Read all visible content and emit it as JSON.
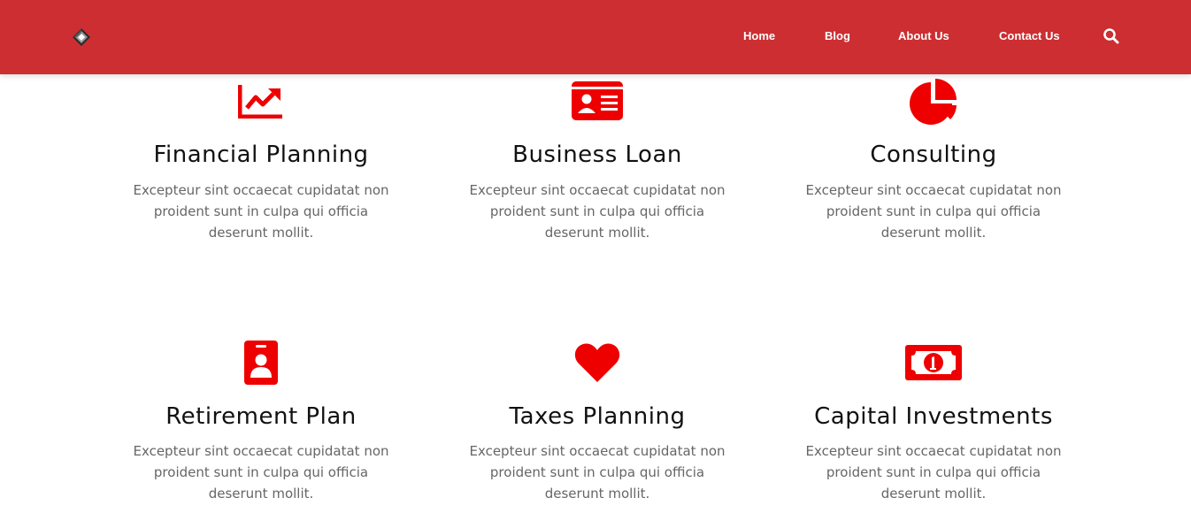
{
  "header": {
    "background": "#cc2e31",
    "logo_icon": "diamond-logo-icon",
    "nav": [
      {
        "label": "Home"
      },
      {
        "label": "Blog"
      },
      {
        "label": "About Us"
      },
      {
        "label": "Contact Us"
      }
    ],
    "search_icon": "search-icon"
  },
  "accent_color": "#ee0000",
  "services": [
    {
      "title": "Financial Planning",
      "description": "Excepteur sint occaecat cupidatat non proident sunt in culpa qui officia deserunt mollit.",
      "icon": "chart-line-icon"
    },
    {
      "title": "Business Loan",
      "description": "Excepteur sint occaecat cupidatat non proident sunt in culpa qui officia deserunt mollit.",
      "icon": "id-card-icon"
    },
    {
      "title": "Consulting",
      "description": "Excepteur sint occaecat cupidatat non proident sunt in culpa qui officia deserunt mollit.",
      "icon": "pie-chart-icon"
    },
    {
      "title": "Retirement Plan",
      "description": "Excepteur sint occaecat cupidatat non proident sunt in culpa qui officia deserunt mollit.",
      "icon": "id-badge-icon"
    },
    {
      "title": "Taxes Planning",
      "description": "Excepteur sint occaecat cupidatat non proident sunt in culpa qui officia deserunt mollit.",
      "icon": "heart-icon"
    },
    {
      "title": "Capital Investments",
      "description": "Excepteur sint occaecat cupidatat non proident sunt in culpa qui officia deserunt mollit.",
      "icon": "money-bill-icon"
    }
  ]
}
